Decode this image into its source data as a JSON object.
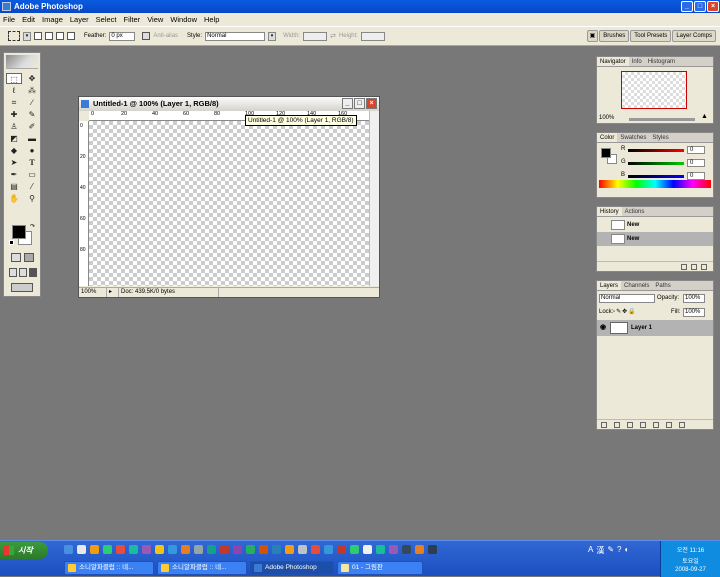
{
  "app": {
    "title": "Adobe Photoshop"
  },
  "menu": [
    "File",
    "Edit",
    "Image",
    "Layer",
    "Select",
    "Filter",
    "View",
    "Window",
    "Help"
  ],
  "options": {
    "feather_label": "Feather:",
    "feather_value": "0 px",
    "antialias_label": "Anti-alias",
    "style_label": "Style:",
    "style_value": "Normal",
    "width_label": "Width:",
    "height_label": "Height:"
  },
  "wells": [
    "Brushes",
    "Tool Presets",
    "Layer Comps"
  ],
  "document": {
    "title": "Untitled-1 @ 100% (Layer 1, RGB/8)",
    "tooltip": "Untitled-1 @ 100% (Layer 1, RGB/8)",
    "zoom": "100%",
    "doc_info": "Doc: 439.5K/0 bytes",
    "ruler_h": [
      "0",
      "20",
      "40",
      "60",
      "80",
      "100",
      "120",
      "140",
      "160"
    ],
    "ruler_v": [
      "0",
      "20",
      "40",
      "60",
      "80"
    ]
  },
  "navigator": {
    "tabs": [
      "Navigator",
      "Info",
      "Histogram"
    ],
    "zoom": "100%"
  },
  "color": {
    "tabs": [
      "Color",
      "Swatches",
      "Styles"
    ],
    "r_label": "R",
    "g_label": "G",
    "b_label": "B",
    "r": "0",
    "g": "0",
    "b": "0"
  },
  "history": {
    "tabs": [
      "History",
      "Actions"
    ],
    "snapshot": "New",
    "state": "New"
  },
  "layers": {
    "tabs": [
      "Layers",
      "Channels",
      "Paths"
    ],
    "blend": "Normal",
    "opacity_label": "Opacity:",
    "opacity": "100%",
    "lock_label": "Lock:",
    "fill_label": "Fill:",
    "fill": "100%",
    "layer_name": "Layer 1"
  },
  "taskbar": {
    "start": "시작",
    "buttons": [
      "소니알파클럽 :: 네...",
      "소니알파클럽 :: 네...",
      "Adobe Photoshop",
      "01 - 그림판"
    ],
    "time": "오전 11:16",
    "day": "토요일",
    "date": "2008-09-27"
  }
}
